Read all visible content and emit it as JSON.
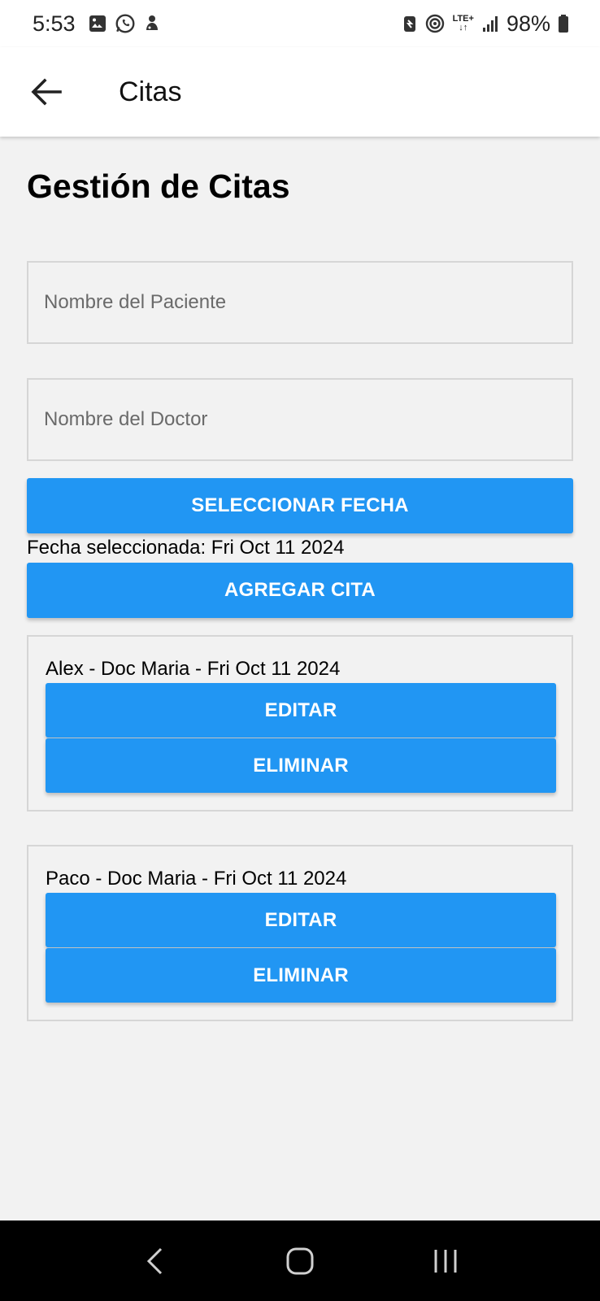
{
  "status_bar": {
    "time": "5:53",
    "battery": "98%",
    "network": "LTE+",
    "left_icons": [
      "gallery-icon",
      "whatsapp-icon",
      "notification-icon"
    ],
    "right_icons": [
      "battery-saver-icon",
      "hotspot-icon",
      "lte-icon",
      "signal-icon",
      "battery-icon"
    ]
  },
  "app_bar": {
    "title": "Citas",
    "back_icon": "arrow-left-icon"
  },
  "page": {
    "heading": "Gestión de Citas",
    "patient_placeholder": "Nombre del Paciente",
    "patient_value": "",
    "doctor_placeholder": "Nombre del Doctor",
    "doctor_value": "",
    "select_date_label": "SELECCIONAR FECHA",
    "selected_date_text": "Fecha seleccionada: Fri Oct 11 2024",
    "add_label": "AGREGAR CITA"
  },
  "appointments": [
    {
      "text": "Alex - Doc Maria - Fri Oct 11 2024",
      "edit_label": "EDITAR",
      "delete_label": "ELIMINAR"
    },
    {
      "text": "Paco - Doc Maria - Fri Oct 11 2024",
      "edit_label": "EDITAR",
      "delete_label": "ELIMINAR"
    }
  ],
  "nav_bar": {
    "buttons": [
      "back-nav-icon",
      "home-nav-icon",
      "recents-nav-icon"
    ]
  },
  "colors": {
    "accent": "#2196f3",
    "background": "#f2f2f2",
    "app_bar": "#ffffff",
    "nav_bar": "#000000"
  }
}
